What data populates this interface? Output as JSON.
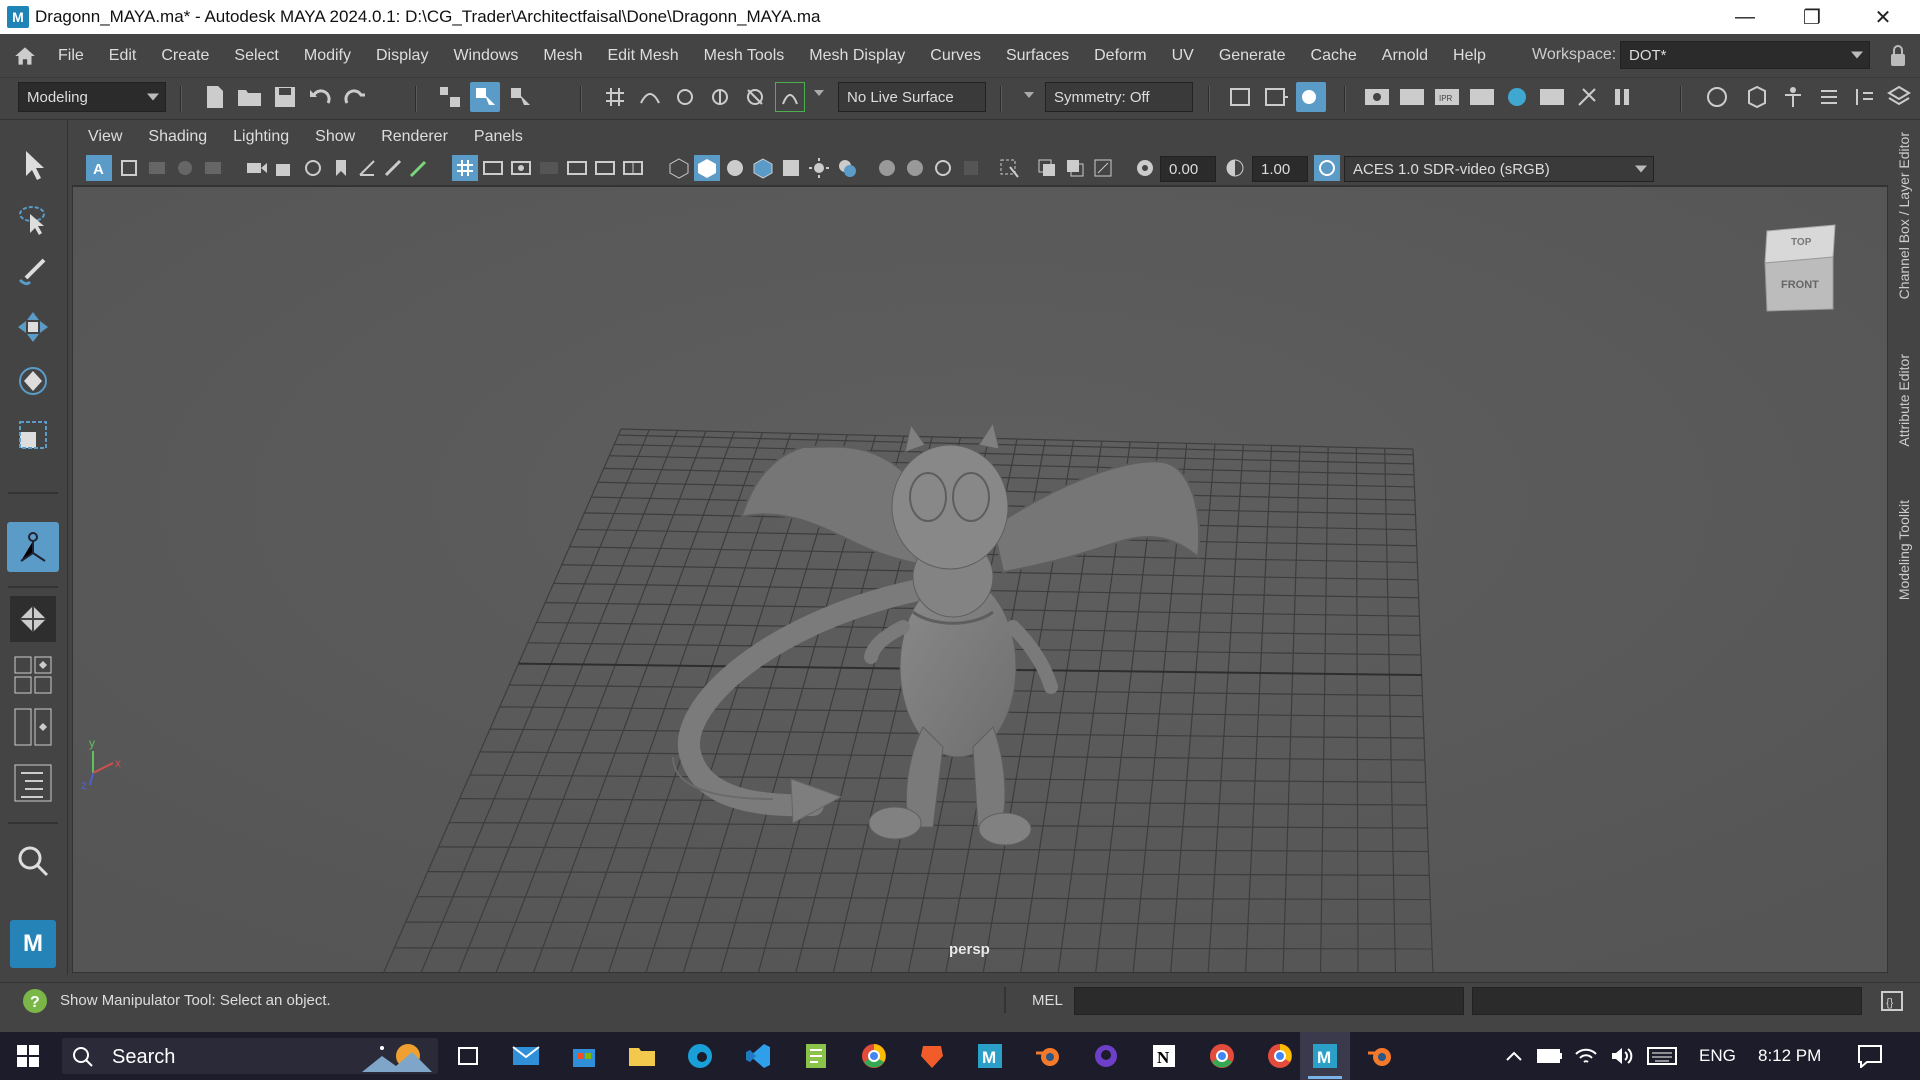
{
  "window": {
    "title": "Dragonn_MAYA.ma* - Autodesk MAYA 2024.0.1: D:\\CG_Trader\\Architectfaisal\\Done\\Dragonn_MAYA.ma",
    "app_icon_letter": "M",
    "controls": {
      "minimize": "—",
      "maximize": "❐",
      "close": "✕"
    }
  },
  "menubar": {
    "items": [
      "File",
      "Edit",
      "Create",
      "Select",
      "Modify",
      "Display",
      "Windows",
      "Mesh",
      "Edit Mesh",
      "Mesh Tools",
      "Mesh Display",
      "Curves",
      "Surfaces",
      "Deform",
      "UV",
      "Generate",
      "Cache",
      "Arnold",
      "Help"
    ],
    "workspace_label": "Workspace:",
    "workspace_value": "DOT*"
  },
  "statusline": {
    "menuset": "Modeling",
    "live_surface": "No Live Surface",
    "symmetry": "Symmetry: Off"
  },
  "panel": {
    "menus": [
      "View",
      "Shading",
      "Lighting",
      "Show",
      "Renderer",
      "Panels"
    ],
    "exposure": "0.00",
    "gamma": "1.00",
    "color_space": "ACES 1.0 SDR-video (sRGB)",
    "camera_label": "persp",
    "viewcube": {
      "top": "TOP",
      "front": "FRONT"
    },
    "axis": {
      "x": "x",
      "y": "y",
      "z": "z"
    }
  },
  "sidebar_tabs": [
    "Channel Box / Layer Editor",
    "Attribute Editor",
    "Modeling Toolkit"
  ],
  "helpline": {
    "message": "Show Manipulator Tool: Select an object.",
    "command_language": "MEL"
  },
  "taskbar": {
    "search_placeholder": "Search",
    "language": "ENG",
    "time": "8:12 PM"
  },
  "colors": {
    "ui_bg": "#444444",
    "viewport_bg": "#5a5a5a",
    "accent": "#5a9bc7",
    "taskbar": "#1c1c2a"
  }
}
